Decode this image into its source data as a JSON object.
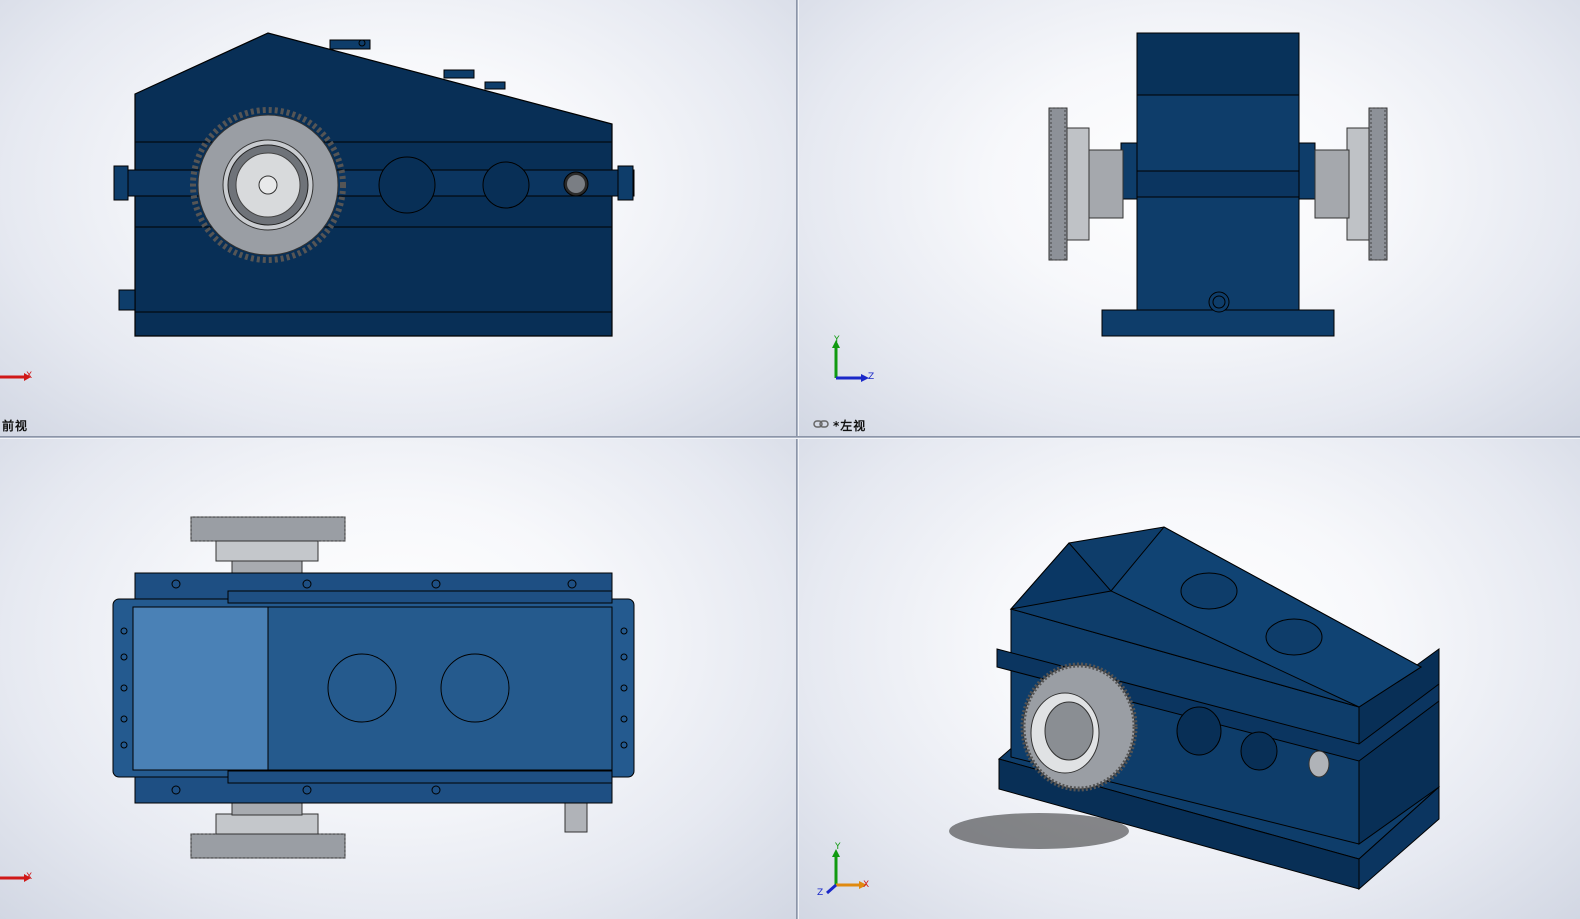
{
  "viewports": {
    "front": {
      "label": "前视"
    },
    "left": {
      "label": "*左视"
    },
    "top": {
      "label": ""
    },
    "iso": {
      "label": ""
    }
  },
  "triad_labels": {
    "x": "X",
    "y": "Y",
    "z": "Z"
  },
  "colors": {
    "housing_dark": "#082f56",
    "housing_mid": "#0e3d6a",
    "housing_light": "#2e5f93",
    "gear_metal": "#9a9ea4",
    "axis_x": "#d01818",
    "axis_y": "#109a10",
    "axis_z": "#1a28c8"
  }
}
